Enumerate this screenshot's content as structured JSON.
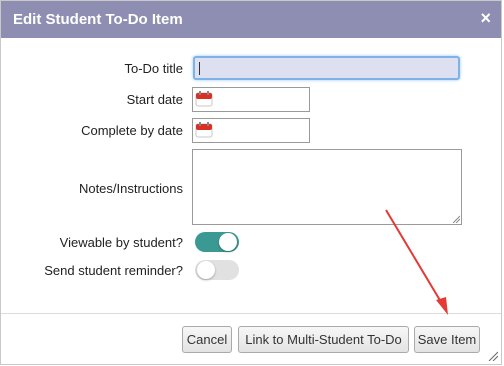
{
  "dialog": {
    "title": "Edit Student To-Do Item",
    "close_glyph": "×"
  },
  "form": {
    "todo_title_label": "To-Do title",
    "todo_title_value": "",
    "start_date_label": "Start date",
    "start_date_value": "",
    "complete_by_label": "Complete by date",
    "complete_by_value": "",
    "notes_label": "Notes/Instructions",
    "notes_value": "",
    "viewable_label": "Viewable by student?",
    "viewable_on": true,
    "reminder_label": "Send student reminder?",
    "reminder_on": false
  },
  "buttons": {
    "cancel": "Cancel",
    "link": "Link to Multi-Student To-Do",
    "save": "Save Item"
  },
  "colors": {
    "titlebar": "#8e8eb3",
    "toggle_on": "#3a9a93",
    "toggle_off": "#e1e1e1",
    "annotation_arrow": "#e53935"
  },
  "icons": {
    "calendar": "calendar-icon",
    "close": "close-icon"
  }
}
